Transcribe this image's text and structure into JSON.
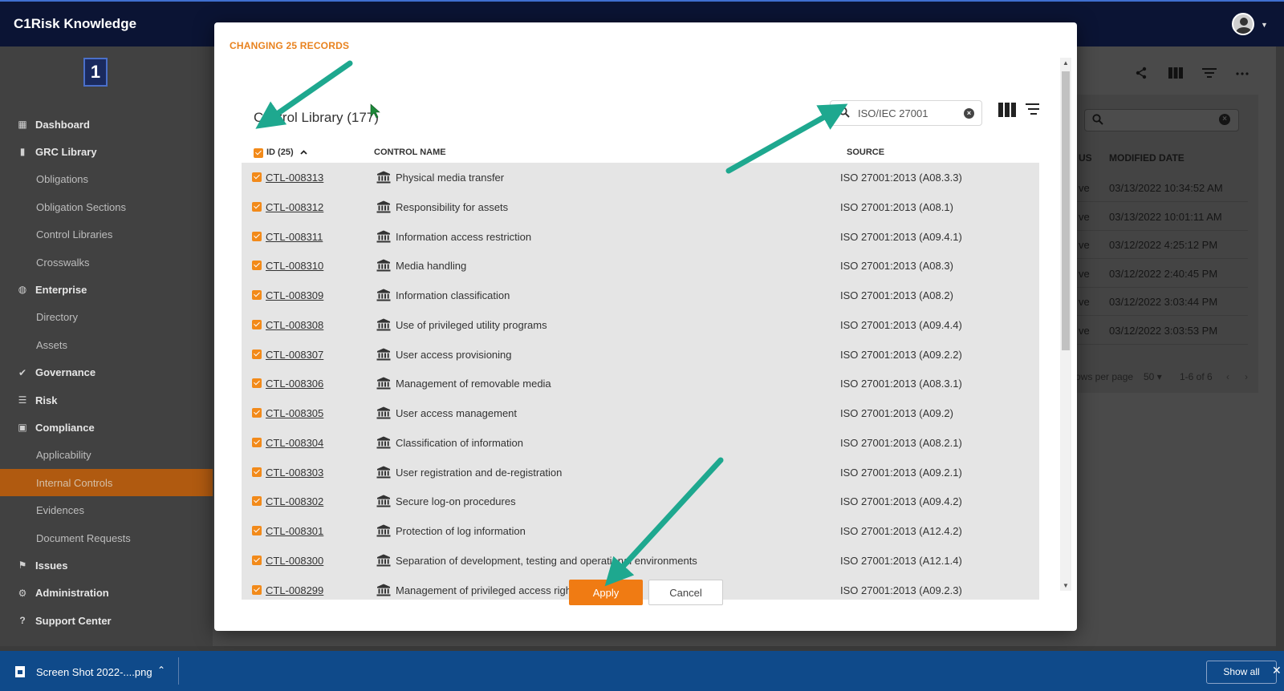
{
  "app": {
    "title": "C1Risk Knowledge"
  },
  "sidebar": {
    "items": [
      {
        "label": "Dashboard",
        "type": "top",
        "icon": "dashboard-icon"
      },
      {
        "label": "GRC Library",
        "type": "top",
        "icon": "book-icon"
      },
      {
        "label": "Obligations",
        "type": "sub"
      },
      {
        "label": "Obligation Sections",
        "type": "sub"
      },
      {
        "label": "Control Libraries",
        "type": "sub"
      },
      {
        "label": "Crosswalks",
        "type": "sub"
      },
      {
        "label": "Enterprise",
        "type": "top",
        "icon": "globe-icon"
      },
      {
        "label": "Directory",
        "type": "sub"
      },
      {
        "label": "Assets",
        "type": "sub"
      },
      {
        "label": "Governance",
        "type": "top",
        "icon": "check-double-icon"
      },
      {
        "label": "Risk",
        "type": "top",
        "icon": "list-icon"
      },
      {
        "label": "Compliance",
        "type": "top",
        "icon": "clipboard-icon"
      },
      {
        "label": "Applicability",
        "type": "sub"
      },
      {
        "label": "Internal Controls",
        "type": "sub",
        "active": true
      },
      {
        "label": "Evidences",
        "type": "sub"
      },
      {
        "label": "Document Requests",
        "type": "sub"
      },
      {
        "label": "Issues",
        "type": "top",
        "icon": "flag-icon"
      },
      {
        "label": "Administration",
        "type": "top",
        "icon": "gear-icon"
      },
      {
        "label": "Support Center",
        "type": "top",
        "icon": "help-icon"
      }
    ]
  },
  "background_table": {
    "col_status_partial": "US",
    "col_modified": "MODIFIED DATE",
    "rows": [
      {
        "status_partial": "ve",
        "modified": "03/13/2022 10:34:52 AM"
      },
      {
        "status_partial": "ve",
        "modified": "03/13/2022 10:01:11 AM"
      },
      {
        "status_partial": "ve",
        "modified": "03/12/2022 4:25:12 PM"
      },
      {
        "status_partial": "ve",
        "modified": "03/12/2022 2:40:45 PM"
      },
      {
        "status_partial": "ve",
        "modified": "03/12/2022 3:03:44 PM"
      },
      {
        "status_partial": "ve",
        "modified": "03/12/2022 3:03:53 PM"
      }
    ],
    "rows_per_page_label": "ows per page",
    "rows_per_page_value": "50",
    "range": "1-6 of 6"
  },
  "modal": {
    "title": "CHANGING 25 RECORDS",
    "panel_title": "Control Library (177)",
    "search_value": "ISO/IEC 27001",
    "headers": {
      "id": "ID (25)",
      "name": "CONTROL NAME",
      "source": "SOURCE"
    },
    "rows": [
      {
        "id": "CTL-008313",
        "name": "Physical media transfer",
        "source": "ISO 27001:2013 (A08.3.3)"
      },
      {
        "id": "CTL-008312",
        "name": "Responsibility for assets",
        "source": "ISO 27001:2013 (A08.1)"
      },
      {
        "id": "CTL-008311",
        "name": "Information access restriction",
        "source": "ISO 27001:2013 (A09.4.1)"
      },
      {
        "id": "CTL-008310",
        "name": "Media handling",
        "source": "ISO 27001:2013 (A08.3)"
      },
      {
        "id": "CTL-008309",
        "name": "Information classification",
        "source": "ISO 27001:2013 (A08.2)"
      },
      {
        "id": "CTL-008308",
        "name": "Use of privileged utility programs",
        "source": "ISO 27001:2013 (A09.4.4)"
      },
      {
        "id": "CTL-008307",
        "name": "User access provisioning",
        "source": "ISO 27001:2013 (A09.2.2)"
      },
      {
        "id": "CTL-008306",
        "name": "Management of removable media",
        "source": "ISO 27001:2013 (A08.3.1)"
      },
      {
        "id": "CTL-008305",
        "name": "User access management",
        "source": "ISO 27001:2013 (A09.2)"
      },
      {
        "id": "CTL-008304",
        "name": "Classification of information",
        "source": "ISO 27001:2013 (A08.2.1)"
      },
      {
        "id": "CTL-008303",
        "name": "User registration and de-registration",
        "source": "ISO 27001:2013 (A09.2.1)"
      },
      {
        "id": "CTL-008302",
        "name": "Secure log-on procedures",
        "source": "ISO 27001:2013 (A09.4.2)"
      },
      {
        "id": "CTL-008301",
        "name": "Protection of log information",
        "source": "ISO 27001:2013 (A12.4.2)"
      },
      {
        "id": "CTL-008300",
        "name": "Separation of development, testing and operational environments",
        "source": "ISO 27001:2013 (A12.1.4)"
      },
      {
        "id": "CTL-008299",
        "name": "Management of privileged access rights",
        "source": "ISO 27001:2013 (A09.2.3)"
      }
    ],
    "apply_label": "Apply",
    "cancel_label": "Cancel"
  },
  "downloads": {
    "file_name": "Screen Shot 2022-....png",
    "show_all": "Show all"
  },
  "colors": {
    "accent_orange": "#f07b13",
    "annotation_arrow": "#1ea88f",
    "topbar": "#0b1434",
    "download_bar": "#0f4a8a"
  }
}
